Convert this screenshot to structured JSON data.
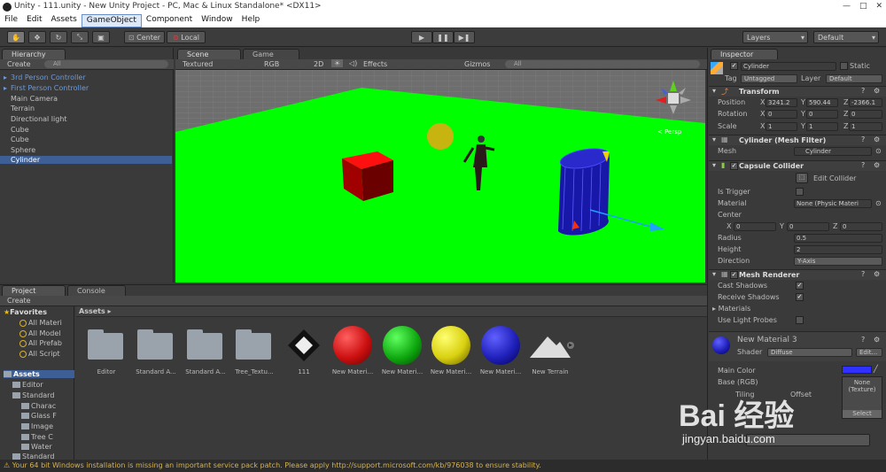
{
  "window": {
    "title": "Unity - 111.unity - New Unity Project - PC, Mac & Linux Standalone* <DX11>",
    "controls": [
      "—",
      "□",
      "✕"
    ]
  },
  "menu": [
    "File",
    "Edit",
    "Assets",
    "GameObject",
    "Component",
    "Window",
    "Help"
  ],
  "toolbar": {
    "center_label": "Center",
    "local_label": "Local",
    "layers_label": "Layers",
    "layout_label": "Default"
  },
  "hierarchy": {
    "tab": "Hierarchy",
    "create": "Create",
    "search_placeholder": "All",
    "items": [
      {
        "label": "3rd Person Controller",
        "prefab": true
      },
      {
        "label": "First Person Controller",
        "prefab": true
      },
      {
        "label": "Main Camera"
      },
      {
        "label": "Terrain"
      },
      {
        "label": "Directional light"
      },
      {
        "label": "Cube"
      },
      {
        "label": "Cube"
      },
      {
        "label": "Sphere"
      },
      {
        "label": "Cylinder",
        "selected": true
      }
    ]
  },
  "scene": {
    "tab": "Scene",
    "game_tab": "Game",
    "draw_mode": "Textured",
    "color_mode": "RGB",
    "mode_2d": "2D",
    "effects": "Effects",
    "gizmos": "Gizmos",
    "search_placeholder": "All",
    "persp": "< Persp",
    "ground_color": "#00ff00"
  },
  "project": {
    "tab": "Project",
    "console_tab": "Console",
    "create": "Create",
    "breadcrumb": "Assets ▸",
    "favorites_label": "Favorites",
    "favorites": [
      "All Materi",
      "All Model",
      "All Prefab",
      "All Script"
    ],
    "assets_label": "Assets",
    "tree": [
      {
        "label": "Editor",
        "depth": 1
      },
      {
        "label": "Standard",
        "depth": 1
      },
      {
        "label": "Charac",
        "depth": 2
      },
      {
        "label": "Glass F",
        "depth": 2
      },
      {
        "label": "Image",
        "depth": 2
      },
      {
        "label": "Tree C",
        "depth": 2
      },
      {
        "label": "Water",
        "depth": 2
      },
      {
        "label": "Standard",
        "depth": 1
      }
    ],
    "items": [
      {
        "label": "Editor",
        "type": "folder"
      },
      {
        "label": "Standard A...",
        "type": "folder"
      },
      {
        "label": "Standard A...",
        "type": "folder"
      },
      {
        "label": "Tree_Textu...",
        "type": "folder"
      },
      {
        "label": "111",
        "type": "unity"
      },
      {
        "label": "New Materi...",
        "type": "material",
        "color": "#cc1010"
      },
      {
        "label": "New Materi...",
        "type": "material",
        "color": "#10aa10"
      },
      {
        "label": "New Materi...",
        "type": "material",
        "color": "#d8d010"
      },
      {
        "label": "New Materi...",
        "type": "material",
        "color": "#2020bb"
      },
      {
        "label": "New Terrain",
        "type": "terrain"
      }
    ]
  },
  "inspector": {
    "tab": "Inspector",
    "name": "Cylinder",
    "static_label": "Static",
    "tag_label": "Tag",
    "tag": "Untagged",
    "layer_label": "Layer",
    "layer": "Default",
    "transform": {
      "title": "Transform",
      "position_label": "Position",
      "rotation_label": "Rotation",
      "scale_label": "Scale",
      "position": [
        "3241.2",
        "590.44",
        "-2366.1"
      ],
      "rotation": [
        "0",
        "0",
        "0"
      ],
      "scale": [
        "1",
        "1",
        "1"
      ]
    },
    "mesh_filter": {
      "title": "Cylinder (Mesh Filter)",
      "mesh_label": "Mesh",
      "mesh": "Cylinder"
    },
    "capsule": {
      "title": "Capsule Collider",
      "edit": "Edit Collider",
      "trigger_label": "Is Trigger",
      "material_label": "Material",
      "material": "None (Physic Materi",
      "center_label": "Center",
      "center": [
        "0",
        "0",
        "0"
      ],
      "radius_label": "Radius",
      "radius": "0.5",
      "height_label": "Height",
      "height": "2",
      "direction_label": "Direction",
      "direction": "Y-Axis"
    },
    "renderer": {
      "title": "Mesh Renderer",
      "cast_label": "Cast Shadows",
      "receive_label": "Receive Shadows",
      "materials_label": "Materials",
      "light_label": "Use Light Probes"
    },
    "material": {
      "name": "New Material 3",
      "shader_label": "Shader",
      "shader": "Diffuse",
      "edit": "Edit...",
      "main_color_label": "Main Color",
      "base_label": "Base (RGB)",
      "tiling_label": "Tiling",
      "offset_label": "Offset",
      "texture_none": "None",
      "texture_type": "(Texture)",
      "select": "Select",
      "main_color": "#3030ff"
    }
  },
  "status": "Your 64 bit Windows installation is missing an important service pack patch. Please apply http://support.microsoft.com/kb/976038 to ensure stability.",
  "watermark": {
    "brand": "Bai  经验",
    "url": "jingyan.baidu.com"
  }
}
